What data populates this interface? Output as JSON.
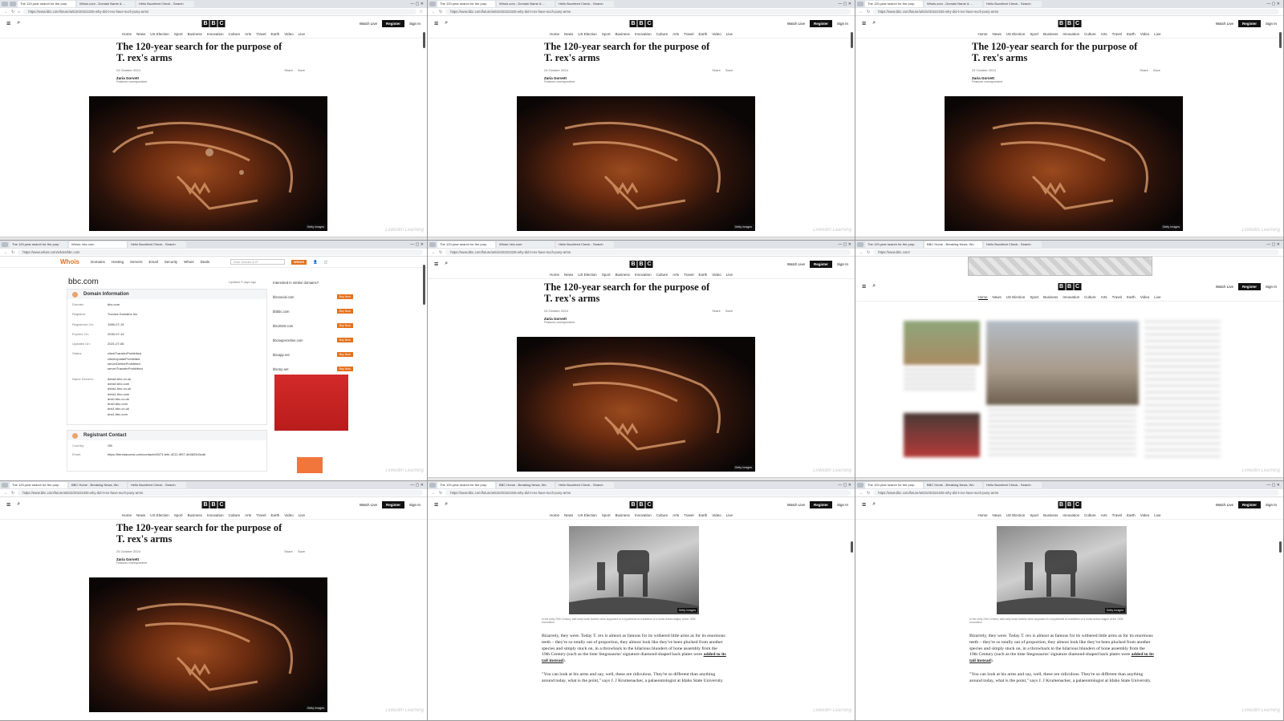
{
  "browser": {
    "tabs_bbc_first": [
      "The 120-year search for the purp",
      "Whois.com - Domain Name & ...",
      "Hello Buzzfeed Check - Search"
    ],
    "tabs_home": [
      "The 120-year search for the purp",
      "BBC Home - Breaking News, Wo",
      "Hello Buzzfeed Check - Search"
    ],
    "tabs_whois": [
      "The 120-year search for the purp",
      "Whois: bbc.com",
      "Hello Buzzfeed Check - Search"
    ],
    "url_article": "https://www.bbc.com/future/article/20221025-why-did-t-rex-have-such-puny-arms",
    "url_whois": "https://www.whois.com/whois/bbc.com",
    "url_home": "https://www.bbc.com/"
  },
  "bbc": {
    "logo": [
      "B",
      "B",
      "C"
    ],
    "watch_live": "Watch Live",
    "register": "Register",
    "sign_in": "Sign In",
    "nav": [
      "Home",
      "News",
      "US Election",
      "Sport",
      "Business",
      "Innovation",
      "Culture",
      "Arts",
      "Travel",
      "Earth",
      "Video",
      "Live"
    ]
  },
  "article": {
    "headline_line1": "The 120-year search for the purpose of",
    "headline_line2": "T. rex's arms",
    "date": "24 October 2024",
    "share": "Share",
    "save": "Save",
    "author": "Zaria Gorvett",
    "role": "Features correspondent",
    "image_credit": "Getty Images",
    "watermark": "LinkedIn Learning",
    "photo_caption": "In the early 20th Century, wild early fossil hunters were supposed to a hypothesis at a skeleton of a horse-drawn wagon at the 1905 excavation.",
    "para1_a": "Bizarrely, they were. Today T. rex is almost as famous for its withered little arms as for its enormous teeth – they're so totally out of proportion, they almost look like they've been plucked from another species and simply stuck on, in a throwback to the hilarious blunders of bone assembly from the 19th Century (such as the time Stegosaurus' signature diamond-shaped back plates were",
    "para1_link": "added to its tail instead",
    "para1_end": ").",
    "para2": "\"You can look at his arms and say, well, these are ridiculous. They're so different than anything around today, what is the point,\" says J. J Krumenacker, a palaeontologist at Idaho State University."
  },
  "whois": {
    "logo": "Whois",
    "nav": [
      "Domains",
      "Hosting",
      "Servers",
      "Email",
      "Security",
      "Whois",
      "Deals"
    ],
    "search_placeholder": "Enter Domain or IP",
    "search_button": "WHOIS",
    "domain": "bbc.com",
    "updated": "Updated 3 days ago",
    "section_domain": "Domain Information",
    "section_registrant": "Registrant Contact",
    "fields": [
      {
        "k": "Domain:",
        "v": "bbc.com"
      },
      {
        "k": "Registrar:",
        "v": "Tucows Domains Inc."
      },
      {
        "k": "Registered On:",
        "v": "1989-07-15"
      },
      {
        "k": "Expires On:",
        "v": "2030-07-14"
      },
      {
        "k": "Updated On:",
        "v": "2021-07-06"
      },
      {
        "k": "Status:",
        "v": "clientTransferProhibited\nclientUpdateProhibited\nserverDeleteProhibited\nserverTransferProhibited"
      },
      {
        "k": "Name Servers:",
        "v": "ddns0.bbc.co.uk\nddns0.bbc.com\nddns1.bbc.co.uk\nddns1.bbc.com\ndns0.bbc.co.uk\ndns0.bbc.com\ndns1.bbc.co.uk\ndns1.bbc.com"
      }
    ],
    "registrant_fields": [
      {
        "k": "Country:",
        "v": "GB"
      },
      {
        "k": "Email:",
        "v": "https://tieredaccess.com/contact/d9073-fefe-4212-9f07-4b5829d3cdb"
      }
    ],
    "similar_heading": "Interested in similar domains?",
    "similar": [
      "bbcsocial.com",
      "bbbbc.com",
      "bbc2020.com",
      "bbcsuperonline.com",
      "bbcapp.net",
      "bbcmp.net"
    ],
    "buy_now": "Buy Now"
  }
}
